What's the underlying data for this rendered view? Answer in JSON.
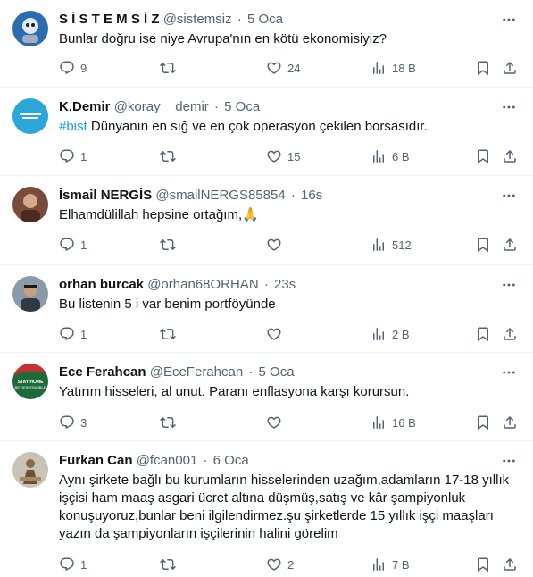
{
  "tweets": [
    {
      "name": "S İ S T E M S İ Z",
      "handle": "@sistemsiz",
      "dot": "·",
      "time": "5 Oca",
      "text": "Bunlar doğru ise niye Avrupa'nın en kötü ekonomisiyiz?",
      "replies": "9",
      "retweets": "",
      "likes": "24",
      "views": "18 B",
      "avatar_color": "#2b6cb0"
    },
    {
      "name": "K.Demir",
      "handle": "@koray__demir",
      "dot": "·",
      "time": "5 Oca",
      "hashtag": "#bist",
      "text": " Dünyanın en sığ ve en çok operasyon çekilen borsasıdır.",
      "replies": "1",
      "retweets": "",
      "likes": "15",
      "views": "6 B",
      "avatar_color": "#2aa7d8"
    },
    {
      "name": "İsmail NERGİS",
      "handle": "@smailNERGS85854",
      "dot": "·",
      "time": "16s",
      "text": "Elhamdülillah hepsine ortağım,🙏",
      "replies": "1",
      "retweets": "",
      "likes": "",
      "views": "512",
      "avatar_color": "#7a4a3a"
    },
    {
      "name": "orhan burcak",
      "handle": "@orhan68ORHAN",
      "dot": "·",
      "time": "23s",
      "text": "Bu listenin 5 i var benim portföyünde",
      "replies": "1",
      "retweets": "",
      "likes": "",
      "views": "2 B",
      "avatar_color": "#8a9aa8"
    },
    {
      "name": "Ece Ferahcan",
      "handle": "@EceFerahcan",
      "dot": "·",
      "time": "5 Oca",
      "text": "Yatırım hisseleri, al unut. Paranı enflasyona karşı korursun.",
      "replies": "3",
      "retweets": "",
      "likes": "",
      "views": "16 B",
      "avatar_color": "#1e6b3a",
      "avatar_text_1": "STAY HOME",
      "avatar_text_2": "BE RESPONSIBLE"
    },
    {
      "name": "Furkan Can",
      "handle": "@fcan001",
      "dot": "·",
      "time": "6 Oca",
      "text_lines": [
        "Aynı şirkete bağlı bu kurumların hisselerinden uzağım,adamların 17-18 yıllık",
        "işçisi ham maaş asgari ücret altına düşmüş,satış ve kâr şampiyonluk",
        "konuşuyoruz,bunlar beni ilgilendirmez.şu şirketlerde 15 yıllık işçi maaşları",
        "yazın da şampiyonların işçilerinin halini görelim"
      ],
      "replies": "1",
      "retweets": "",
      "likes": "2",
      "views": "7 B",
      "avatar_color": "#c9c3b4"
    }
  ],
  "icons": {
    "reply": "reply-icon",
    "retweet": "retweet-icon",
    "like": "heart-icon",
    "views": "views-icon",
    "bookmark": "bookmark-icon",
    "share": "share-icon",
    "more": "more-icon"
  },
  "colors": {
    "text_primary": "#0f1419",
    "text_secondary": "#536471",
    "link": "#1d9bf0",
    "divider": "#eff3f4"
  }
}
